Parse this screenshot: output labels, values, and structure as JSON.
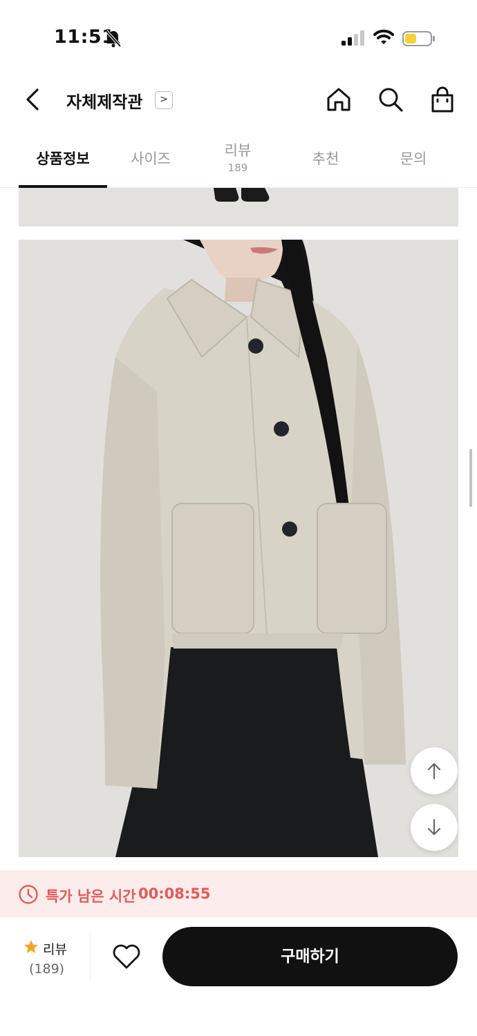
{
  "status_bar": {
    "time": "11:51",
    "icons": [
      "bell-slash-icon",
      "signal-icon",
      "wifi-icon",
      "battery-icon"
    ],
    "battery_color": "#f5d23c"
  },
  "header": {
    "shop_name": "자체제작관",
    "shop_chevron": ">",
    "icons": [
      "back-icon",
      "home-icon",
      "search-icon",
      "cart-icon"
    ]
  },
  "tabs": [
    {
      "label": "상품정보",
      "sub": "",
      "active": true
    },
    {
      "label": "사이즈",
      "sub": "",
      "active": false
    },
    {
      "label": "리뷰",
      "sub": "189",
      "active": false
    },
    {
      "label": "추천",
      "sub": "",
      "active": false
    },
    {
      "label": "문의",
      "sub": "",
      "active": false
    }
  ],
  "product_images": [
    "model-feet-photo",
    "beige-wool-cropped-jacket-photo"
  ],
  "floating_buttons": [
    "scroll-up-icon",
    "scroll-down-icon"
  ],
  "timer": {
    "label": "특가 남은 시간",
    "value": "00:08:55",
    "color": "#e25a5a",
    "background": "#fdecec"
  },
  "bottom_bar": {
    "review_label": "리뷰",
    "review_count": "(189)",
    "buy_label": "구매하기",
    "star_color": "#f5a623"
  }
}
